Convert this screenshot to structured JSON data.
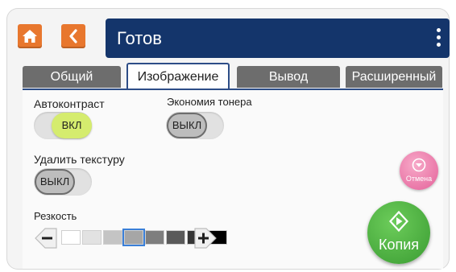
{
  "header": {
    "title": "Готов",
    "colors": {
      "bar": "#14356b",
      "nav_buttons": "#e8772e"
    }
  },
  "tabs": [
    {
      "label": "Общий",
      "active": false
    },
    {
      "label": "Изображение",
      "active": true
    },
    {
      "label": "Вывод",
      "active": false
    },
    {
      "label": "Расширенный",
      "active": false
    }
  ],
  "settings": {
    "autocontrast": {
      "label": "Автоконтраст",
      "state": "ВКЛ",
      "on": true
    },
    "toner_saving": {
      "label": "Экономия тонера",
      "state": "ВЫКЛ",
      "on": false
    },
    "remove_texture": {
      "label": "Удалить текстуру",
      "state": "ВЫКЛ",
      "on": false
    },
    "sharpness": {
      "label": "Резкость",
      "levels": [
        "#ffffff",
        "#e2e2e2",
        "#c4c4c4",
        "#a6a6a6",
        "#7e7e7e",
        "#5a5a5a",
        "#353535",
        "#000000"
      ],
      "selected_level": 4
    }
  },
  "actions": {
    "cancel_label": "Отмена",
    "copy_label": "Копия",
    "colors": {
      "cancel": "#e4629a",
      "copy": "#3a9c32"
    }
  }
}
